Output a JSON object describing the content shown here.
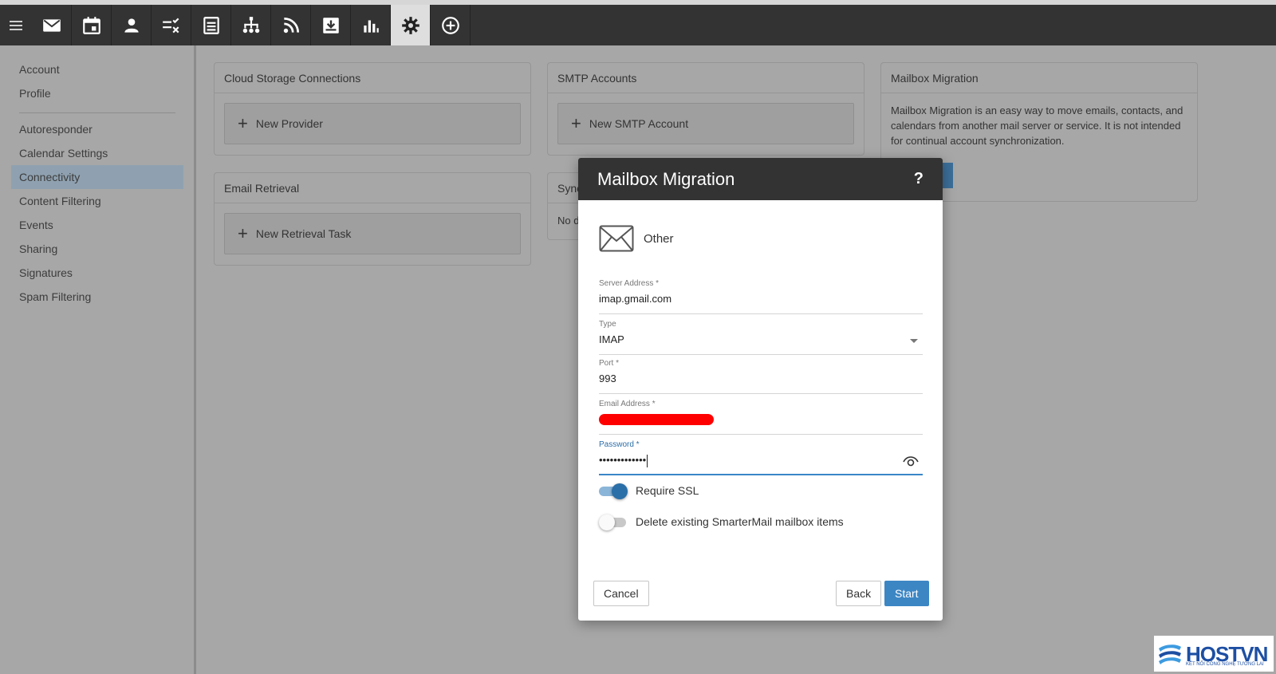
{
  "toolbar": {
    "buttons": [
      {
        "icon": "mail-icon"
      },
      {
        "icon": "calendar-icon"
      },
      {
        "icon": "contacts-icon"
      },
      {
        "icon": "tasks-icon"
      },
      {
        "icon": "notes-icon"
      },
      {
        "icon": "sitemap-icon"
      },
      {
        "icon": "rss-icon"
      },
      {
        "icon": "archive-icon"
      },
      {
        "icon": "reports-icon"
      },
      {
        "icon": "settings-icon",
        "active": true
      },
      {
        "icon": "add-icon"
      }
    ]
  },
  "sidebar": {
    "top": [
      "Account",
      "Profile"
    ],
    "items": [
      "Autoresponder",
      "Calendar Settings",
      "Connectivity",
      "Content Filtering",
      "Events",
      "Sharing",
      "Signatures",
      "Spam Filtering"
    ],
    "active": "Connectivity"
  },
  "cards": {
    "cloud": {
      "title": "Cloud Storage Connections",
      "button": "New Provider"
    },
    "smtp": {
      "title": "SMTP Accounts",
      "button": "New SMTP Account"
    },
    "migration": {
      "title": "Mailbox Migration",
      "text": "Mailbox Migration is an easy way to move emails, contacts, and calendars from another mail server or service. It is not intended for continual account synchronization."
    },
    "retrieval": {
      "title": "Email Retrieval",
      "button": "New Retrieval Task"
    },
    "sync": {
      "title": "Sync",
      "text": "No d"
    }
  },
  "modal": {
    "title": "Mailbox Migration",
    "help": "?",
    "provider": "Other",
    "server_label": "Server Address *",
    "server_value": "imap.gmail.com",
    "type_label": "Type",
    "type_value": "IMAP",
    "port_label": "Port *",
    "port_value": "993",
    "email_label": "Email Address *",
    "password_label": "Password *",
    "password_value": "•••••••••••••",
    "ssl_label": "Require SSL",
    "ssl_on": true,
    "delete_label": "Delete existing SmarterMail mailbox items",
    "delete_on": false,
    "cancel": "Cancel",
    "back": "Back",
    "start": "Start"
  },
  "logo": {
    "name": "HOSTVN",
    "tagline": "KẾT NỐI CÔNG NGHỆ TƯƠNG LAI"
  }
}
